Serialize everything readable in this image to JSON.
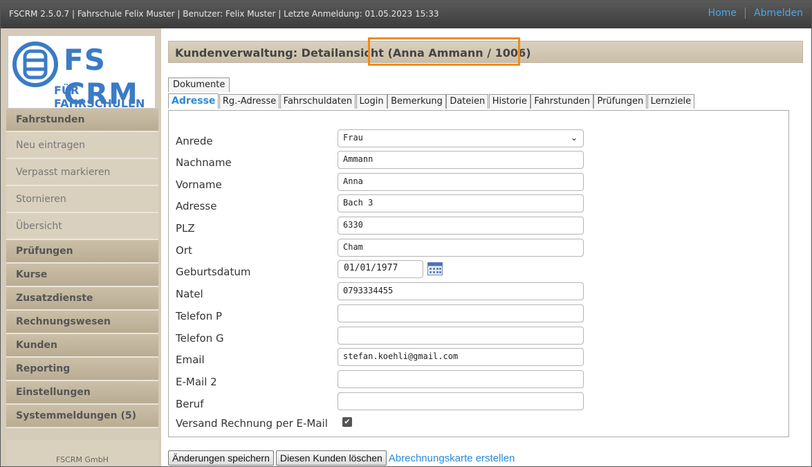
{
  "header": {
    "info": "FSCRM 2.5.0.7 | Fahrschule Felix Muster | Benutzer: Felix Muster | Letzte Anmeldung: 01.05.2023 15:33",
    "home": "Home",
    "logout": "Abmelden"
  },
  "logo": {
    "title": "FS CRM",
    "subtitle": "FÜR FAHRSCHULEN"
  },
  "sidebar": {
    "items": [
      {
        "label": "Fahrstunden",
        "type": "head"
      },
      {
        "label": "Neu eintragen",
        "type": "sub"
      },
      {
        "label": "Verpasst markieren",
        "type": "sub"
      },
      {
        "label": "Stornieren",
        "type": "sub"
      },
      {
        "label": "Übersicht",
        "type": "sub"
      },
      {
        "label": "Prüfungen",
        "type": "head"
      },
      {
        "label": "Kurse",
        "type": "head"
      },
      {
        "label": "Zusatzdienste",
        "type": "head"
      },
      {
        "label": "Rechnungswesen",
        "type": "head"
      },
      {
        "label": "Kunden",
        "type": "head"
      },
      {
        "label": "Reporting",
        "type": "head"
      },
      {
        "label": "Einstellungen",
        "type": "head"
      },
      {
        "label": "Systemmeldungen (5)",
        "type": "head"
      }
    ],
    "footer": "FSCRM GmbH"
  },
  "main": {
    "title": "Kundenverwaltung: Detailansicht",
    "title_customer": "(Anna Ammann / 1006)",
    "tabs_top": [
      "Dokumente"
    ],
    "tabs": [
      "Adresse",
      "Rg.-Adresse",
      "Fahrschuldaten",
      "Login",
      "Bemerkung",
      "Dateien",
      "Historie",
      "Fahrstunden",
      "Prüfungen",
      "Lernziele"
    ],
    "active_tab": "Adresse"
  },
  "form": {
    "anrede": {
      "label": "Anrede",
      "value": "Frau"
    },
    "nachname": {
      "label": "Nachname",
      "value": "Ammann"
    },
    "vorname": {
      "label": "Vorname",
      "value": "Anna"
    },
    "adresse": {
      "label": "Adresse",
      "value": "Bach 3"
    },
    "plz": {
      "label": "PLZ",
      "value": "6330"
    },
    "ort": {
      "label": "Ort",
      "value": "Cham"
    },
    "geburtsdatum": {
      "label": "Geburtsdatum",
      "value": "01/01/1977"
    },
    "natel": {
      "label": "Natel",
      "value": "0793334455"
    },
    "telefon_p": {
      "label": "Telefon P",
      "value": ""
    },
    "telefon_g": {
      "label": "Telefon G",
      "value": ""
    },
    "email": {
      "label": "Email",
      "value": "stefan.koehli@gmail.com"
    },
    "email2": {
      "label": "E-Mail 2",
      "value": ""
    },
    "beruf": {
      "label": "Beruf",
      "value": ""
    },
    "versand": {
      "label": "Versand Rechnung per E-Mail",
      "checked": true
    }
  },
  "actions": {
    "save": "Änderungen speichern",
    "delete": "Diesen Kunden löschen",
    "card": "Abrechnungskarte erstellen"
  },
  "colors": {
    "accent": "#2a8ad8",
    "highlight": "#f28a15",
    "logo": "#3b7bc6"
  }
}
